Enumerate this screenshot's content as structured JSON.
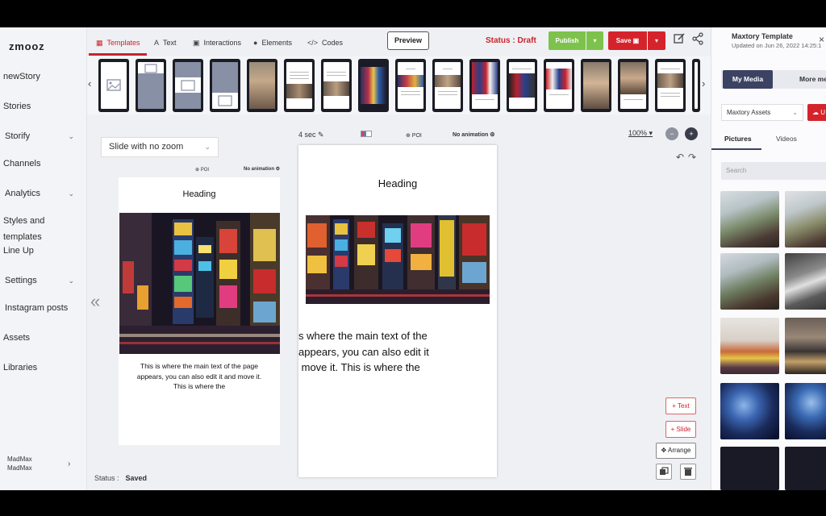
{
  "brand": {
    "logo": "zmooz"
  },
  "nav": {
    "items": [
      {
        "label": "newStory",
        "has_chevron": false
      },
      {
        "label": "Stories",
        "has_chevron": false
      },
      {
        "label": "Storify",
        "has_chevron": true
      },
      {
        "label": "Channels",
        "has_chevron": false
      },
      {
        "label": "Analytics",
        "has_chevron": true
      },
      {
        "label": "Styles and templates",
        "has_chevron": false
      },
      {
        "label": "Line Up",
        "has_chevron": false
      },
      {
        "label": "Settings",
        "has_chevron": true
      },
      {
        "label": "Instagram posts",
        "has_chevron": false
      },
      {
        "label": "Assets",
        "has_chevron": false
      },
      {
        "label": "Libraries",
        "has_chevron": false
      }
    ],
    "user": {
      "name": "MadMax",
      "account": "MadMax"
    }
  },
  "toolbar": {
    "tabs": [
      {
        "label": "Templates",
        "icon": "grid-icon",
        "active": true
      },
      {
        "label": "Text",
        "icon": "text-icon",
        "active": false
      },
      {
        "label": "Interactions",
        "icon": "image-icon",
        "active": false
      },
      {
        "label": "Elements",
        "icon": "circle-icon",
        "active": false
      },
      {
        "label": "Codes",
        "icon": "code-icon",
        "active": false
      }
    ],
    "preview_label": "Preview",
    "status_label": "Status : Draft",
    "publish_label": "Publish",
    "save_label": "Save",
    "caret": "▾",
    "colors": {
      "accent": "#c9232c",
      "publish": "#7dc24b",
      "save": "#d5232c",
      "thumb_frame": "#1c1d24"
    }
  },
  "strip": {
    "prev_arrow": "‹",
    "next_arrow": "›",
    "thumbs": [
      "image-placeholder",
      "image-top-blue",
      "image-mid-blue",
      "image-bottom-blue",
      "photo-people",
      "text-photo",
      "text-photo",
      "photo-city-night",
      "heading-city",
      "heading-photo",
      "flags-photo",
      "photo-dark",
      "photo-flags",
      "photo-people",
      "photo-people",
      "heading-photo-text"
    ]
  },
  "left_panel": {
    "zoom_select": "Slide with no zoom",
    "poi": "⊕ POI",
    "no_animation": "No animation ⚙",
    "heading": "Heading",
    "body_text": "This is where the main text of the page appears, you can also edit it and move it. This is where the",
    "nav_left": "«"
  },
  "canvas": {
    "duration": "4 sec",
    "poi": "⊕ POI",
    "no_animation": "No animation ⚙",
    "heading": "Heading",
    "body_lines": [
      "s where the main text of the",
      "appears, you can also edit it",
      " move it. This is where the"
    ],
    "zoom_level": "100%",
    "zoom_caret": "▾",
    "add_text": "+ Text",
    "add_slide": "+ Slide",
    "arrange": "✥ Arrange"
  },
  "status_bar": {
    "label": "Status :",
    "value": "Saved"
  },
  "right_panel": {
    "template_title": "Maxtory Template",
    "template_subtitle": "Updated on Jun 26, 2022 14:25:1",
    "close": "×",
    "tab_my_media": "My Media",
    "tab_more": "More me",
    "assets_select": "Maxtory Assets",
    "upload_label": "U",
    "media_tabs": [
      "Pictures",
      "Videos"
    ],
    "search_placeholder": "Search",
    "media_items": [
      "friends-outdoor",
      "friends-outdoor",
      "friends-city",
      "friends-smiling",
      "friends-bench",
      "friends-street",
      "concert-lights",
      "concert-lights"
    ]
  }
}
